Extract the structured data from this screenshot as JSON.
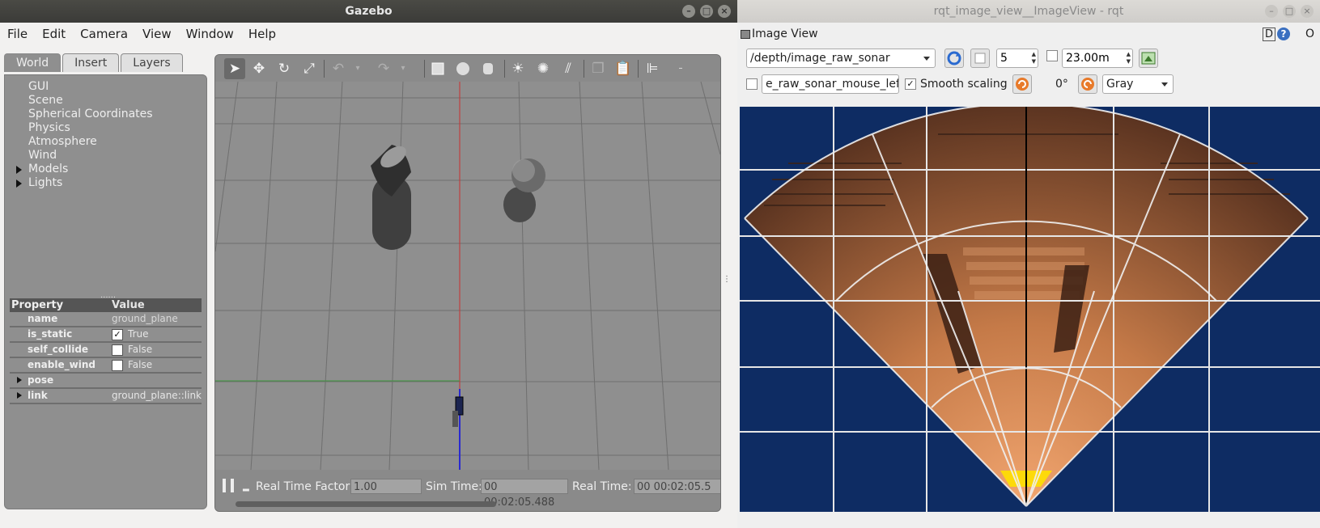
{
  "gazebo": {
    "title": "Gazebo",
    "window_buttons": [
      "–",
      "□",
      "×"
    ],
    "menu": [
      "File",
      "Edit",
      "Camera",
      "View",
      "Window",
      "Help"
    ],
    "tabs": [
      "World",
      "Insert",
      "Layers"
    ],
    "tree_items": [
      "GUI",
      "Scene",
      "Spherical Coordinates",
      "Physics",
      "Atmosphere",
      "Wind",
      "Models",
      "Lights"
    ],
    "props_header": {
      "property": "Property",
      "value": "Value"
    },
    "props": {
      "name": {
        "label": "name",
        "value": "ground_plane"
      },
      "is_static": {
        "label": "is_static",
        "value": "True",
        "check": "✓"
      },
      "self_collide": {
        "label": "self_collide",
        "value": "False"
      },
      "enable_wind": {
        "label": "enable_wind",
        "value": "False"
      },
      "pose": {
        "label": "pose"
      },
      "link": {
        "label": "link",
        "value": "ground_plane::link"
      }
    },
    "bottom": {
      "rtf_label": "Real Time Factor:",
      "rtf_value": "1.00",
      "sim_label": "Sim Time:",
      "sim_value": "00 00:02:05.488",
      "real_label": "Real Time:",
      "real_value": "00 00:02:05.5"
    }
  },
  "rqt": {
    "title": "rqt_image_view__ImageView - rqt",
    "window_buttons": [
      "–",
      "□",
      "×"
    ],
    "plugin_title": "Image View",
    "header_d": "D",
    "header_help": "?",
    "header_o": "O",
    "topic": "/depth/image_raw_sonar",
    "num_value": "5",
    "max_range": "23.00m",
    "mouse_topic": "e_raw_sonar_mouse_left",
    "smooth_label": "Smooth scaling",
    "smooth_check": "✓",
    "rotation": "0°",
    "colormap": "Gray"
  }
}
